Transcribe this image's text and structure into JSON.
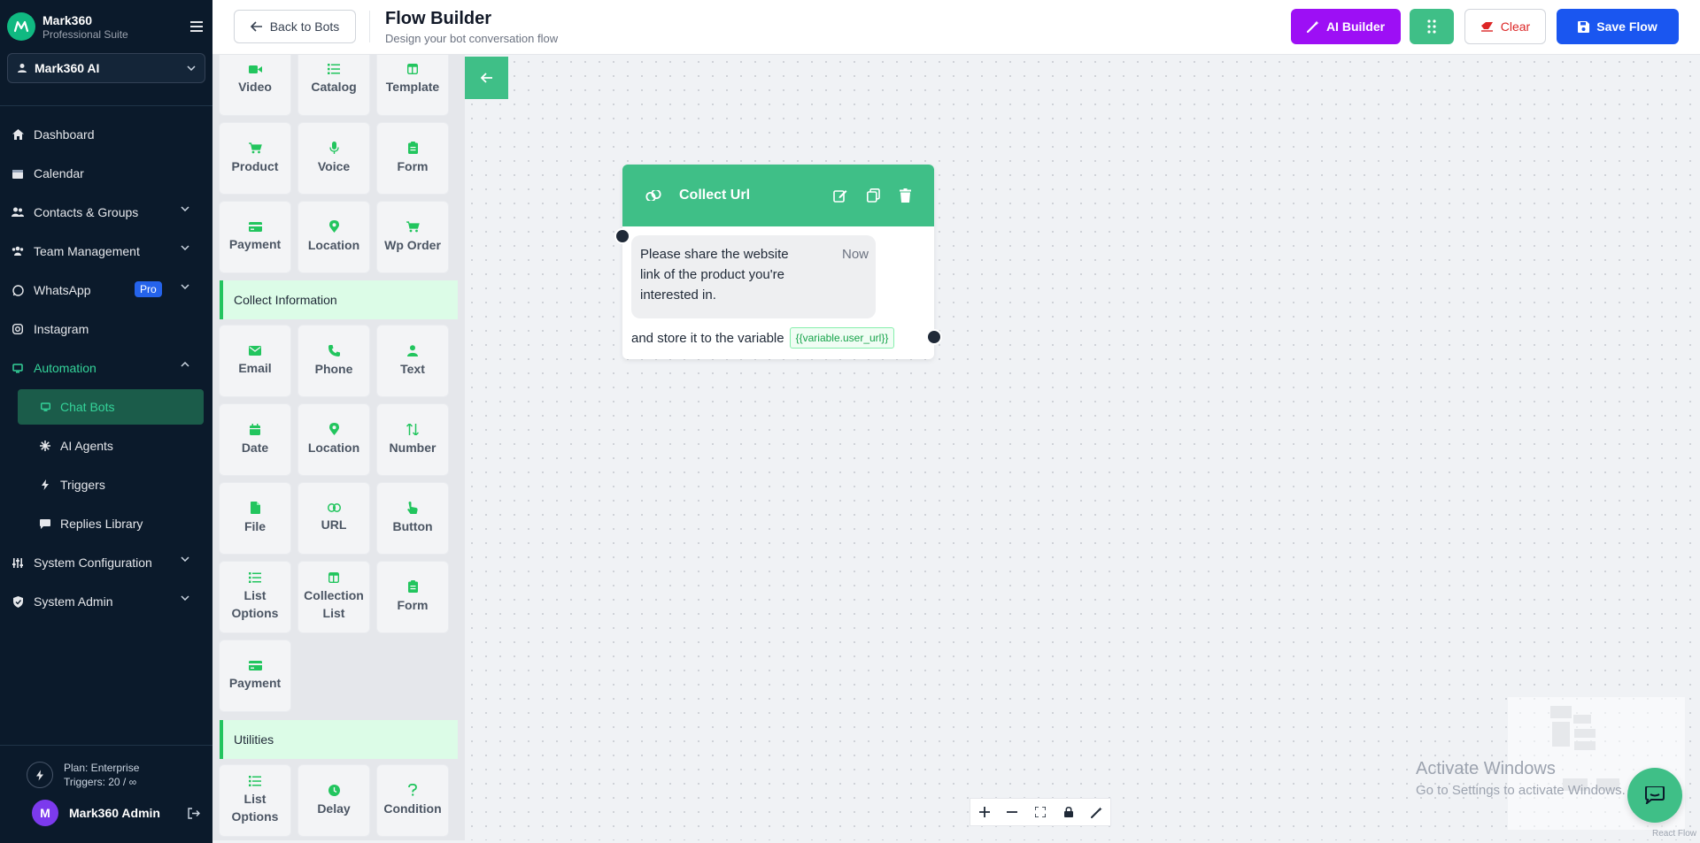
{
  "brand": {
    "name": "Mark360",
    "subtitle": "Professional Suite"
  },
  "workspace": {
    "selected": "Mark360 AI"
  },
  "nav": {
    "dashboard": "Dashboard",
    "calendar": "Calendar",
    "contacts": "Contacts & Groups",
    "team": "Team Management",
    "whatsapp": "WhatsApp",
    "whatsapp_badge": "Pro",
    "instagram": "Instagram",
    "automation": "Automation",
    "automation_children": {
      "chat_bots": "Chat Bots",
      "ai_agents": "AI Agents",
      "triggers": "Triggers",
      "replies_library": "Replies Library"
    },
    "system_config": "System Configuration",
    "system_admin": "System Admin"
  },
  "plan": {
    "name": "Plan: Enterprise",
    "triggers": "Triggers: 20 / ∞"
  },
  "user": {
    "initial": "M",
    "name": "Mark360 Admin"
  },
  "header": {
    "back_label": "Back to Bots",
    "title": "Flow Builder",
    "subtitle": "Design your bot conversation flow",
    "ai_builder_label": "AI Builder",
    "clear_label": "Clear",
    "save_label": "Save Flow"
  },
  "palette": {
    "media": [
      "Video",
      "Catalog",
      "Template",
      "Product",
      "Voice",
      "Form",
      "Payment",
      "Location",
      "Wp Order"
    ],
    "collect_header": "Collect Information",
    "collect": [
      "Email",
      "Phone",
      "Text",
      "Date",
      "Location",
      "Number",
      "File",
      "URL",
      "Button",
      "List Options",
      "Collection List",
      "Form",
      "Payment"
    ],
    "utilities_header": "Utilities",
    "utilities": [
      "List Options",
      "Delay",
      "Condition"
    ]
  },
  "node": {
    "title": "Collect Url",
    "message": "Please share the website link of the product you're interested in.",
    "timestamp": "Now",
    "store_text": "and store it to the variable",
    "variable": "{{variable.user_url}}"
  },
  "watermark": {
    "line1": "Activate Windows",
    "line2": "Go to Settings to activate Windows."
  },
  "attribution": "React Flow",
  "colors": {
    "sidebar_bg": "#0b1a2b",
    "accent_green": "#3fbf87",
    "ai_purple": "#9d0ff5",
    "save_blue": "#1a56f0",
    "clear_red": "#dc2626"
  }
}
